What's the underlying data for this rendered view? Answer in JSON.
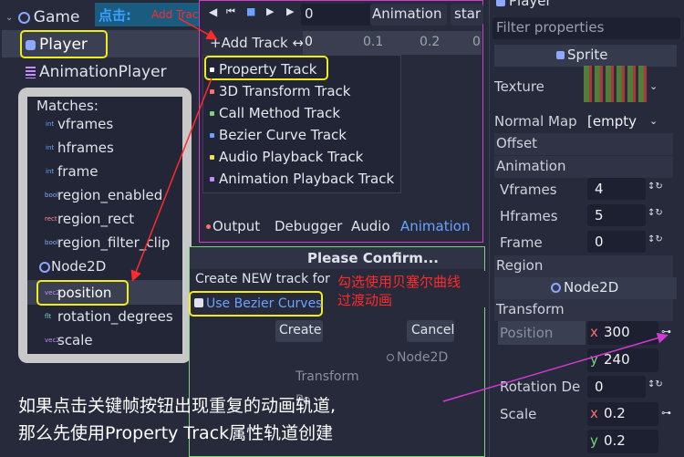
{
  "scene": {
    "game": "Game",
    "player": "Player",
    "animation_player": "AnimationPlayer"
  },
  "matches": {
    "title": "Matches:",
    "items": [
      {
        "type": "int",
        "label": "vframes"
      },
      {
        "type": "int",
        "label": "hframes"
      },
      {
        "type": "int",
        "label": "frame"
      },
      {
        "type": "bool",
        "label": "region_enabled"
      },
      {
        "type": "rect",
        "label": "region_rect"
      },
      {
        "type": "bool",
        "label": "region_filter_clip"
      },
      {
        "type": "node",
        "label": "Node2D"
      },
      {
        "type": "vec2",
        "label": "position"
      },
      {
        "type": "float",
        "label": "rotation_degrees"
      },
      {
        "type": "vec2",
        "label": "scale"
      }
    ]
  },
  "annotations": {
    "click_hint": "点击:",
    "add_track_hint": "Add Track",
    "bezier_hint_1": "勾选使用贝塞尔曲线",
    "bezier_hint_2": "过渡动画",
    "bottom_line_1": "如果点击关键帧按钮出现重复的动画轨道,",
    "bottom_line_2": "那么先使用Property Track属性轨道创建"
  },
  "anim_panel": {
    "time_value": "0",
    "animation_tab": "Animation",
    "start_tab": "star",
    "add_track": "Add Track",
    "ruler": [
      "0",
      "0.1",
      "0.2",
      "0"
    ],
    "menu": [
      {
        "label": "Property Track",
        "color": "#ffffff"
      },
      {
        "label": "3D Transform Track",
        "color": "#ff6e6e"
      },
      {
        "label": "Call Method Track",
        "color": "#7bd37b"
      },
      {
        "label": "Bezier Curve Track",
        "color": "#6aa3ff"
      },
      {
        "label": "Audio Playback Track",
        "color": "#f4e04d"
      },
      {
        "label": "Animation Playback Track",
        "color": "#c58cff"
      }
    ],
    "bottom_tabs": [
      "Output",
      "Debugger",
      "Audio",
      "Animation"
    ]
  },
  "dialog": {
    "title": "Please Confirm...",
    "message": "Create NEW track for p",
    "checkbox_label": "Use Bezier Curves",
    "checked": true,
    "create": "Create",
    "cancel": "Cancel",
    "behind_node": "Node2D",
    "behind_transform": "Transform",
    "behind_po": "Po"
  },
  "inspector": {
    "header": "Player",
    "filter_placeholder": "Filter properties",
    "sprite": "Sprite",
    "texture_label": "Texture",
    "normal_map_label": "Normal Map",
    "normal_map_value": "[empty",
    "offset": "Offset",
    "animation": "Animation",
    "vframes_label": "Vframes",
    "vframes_value": "4",
    "hframes_label": "Hframes",
    "hframes_value": "5",
    "frame_label": "Frame",
    "frame_value": "0",
    "region": "Region",
    "node2d": "Node2D",
    "transform": "Transform",
    "position_label": "Position",
    "position_x": "300",
    "position_y": "240",
    "rotation_label": "Rotation De",
    "rotation_value": "0",
    "scale_label": "Scale",
    "scale_x": "0.2",
    "scale_y": "0.2",
    "x": "x",
    "y": "y"
  },
  "colors": {
    "accent": "#6aa3ff",
    "highlight": "#f3ec1b",
    "annotation": "#ff2a2a",
    "panel": "#262a3b",
    "magenta": "#d03bd0"
  }
}
